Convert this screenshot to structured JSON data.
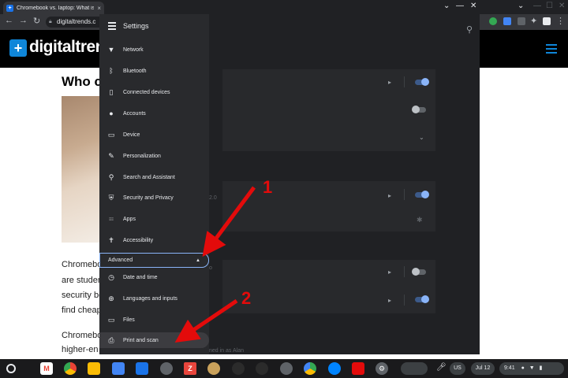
{
  "browser": {
    "tab_title": "Chromebook vs. laptop: What is",
    "tab_close": "×",
    "address": "digitaltrends.c",
    "window_controls": [
      "⌄",
      "—",
      "☐",
      "✕"
    ],
    "right_controls": [
      "⌄",
      "—",
      "☐",
      "✕"
    ]
  },
  "website": {
    "logo_mark": "+",
    "logo_text": "digitaltrend",
    "article_title": "Who c",
    "paragraph1": [
      "Chromebo",
      "are studen",
      "security be",
      "find cheap"
    ],
    "paragraph2": [
      "Chromebo",
      "higher-en"
    ]
  },
  "settings": {
    "title": "Settings",
    "menu_items": [
      {
        "label": "Network",
        "icon": "wifi-icon",
        "glyph": "▼"
      },
      {
        "label": "Bluetooth",
        "icon": "bluetooth-icon",
        "glyph": "ᛒ"
      },
      {
        "label": "Connected devices",
        "icon": "phone-icon",
        "glyph": "▯"
      },
      {
        "label": "Accounts",
        "icon": "person-icon",
        "glyph": "●"
      },
      {
        "label": "Device",
        "icon": "laptop-icon",
        "glyph": "▭"
      },
      {
        "label": "Personalization",
        "icon": "pen-icon",
        "glyph": "✎"
      },
      {
        "label": "Search and Assistant",
        "icon": "search-icon",
        "glyph": "⚲"
      },
      {
        "label": "Security and Privacy",
        "icon": "shield-icon",
        "glyph": "⛨"
      },
      {
        "label": "Apps",
        "icon": "apps-grid-icon",
        "glyph": "⁝⁝⁝"
      },
      {
        "label": "Accessibility",
        "icon": "accessibility-icon",
        "glyph": "✝"
      }
    ],
    "advanced_label": "Advanced",
    "advanced_items": [
      {
        "label": "Date and time",
        "icon": "clock-icon",
        "glyph": "◷"
      },
      {
        "label": "Languages and inputs",
        "icon": "globe-icon",
        "glyph": "⊕"
      },
      {
        "label": "Files",
        "icon": "folder-icon",
        "glyph": "▭"
      },
      {
        "label": "Print and scan",
        "icon": "printer-icon",
        "glyph": "⎙"
      }
    ],
    "faint_texts": {
      "version": "2.0",
      "signed_in": "ned in as Alan",
      "o": "o"
    }
  },
  "annotations": {
    "first": "1",
    "second": "2",
    "color": "#e30b0b"
  },
  "shelf": {
    "keyboard": "US",
    "date": "Jul 12",
    "time": "9:41"
  }
}
